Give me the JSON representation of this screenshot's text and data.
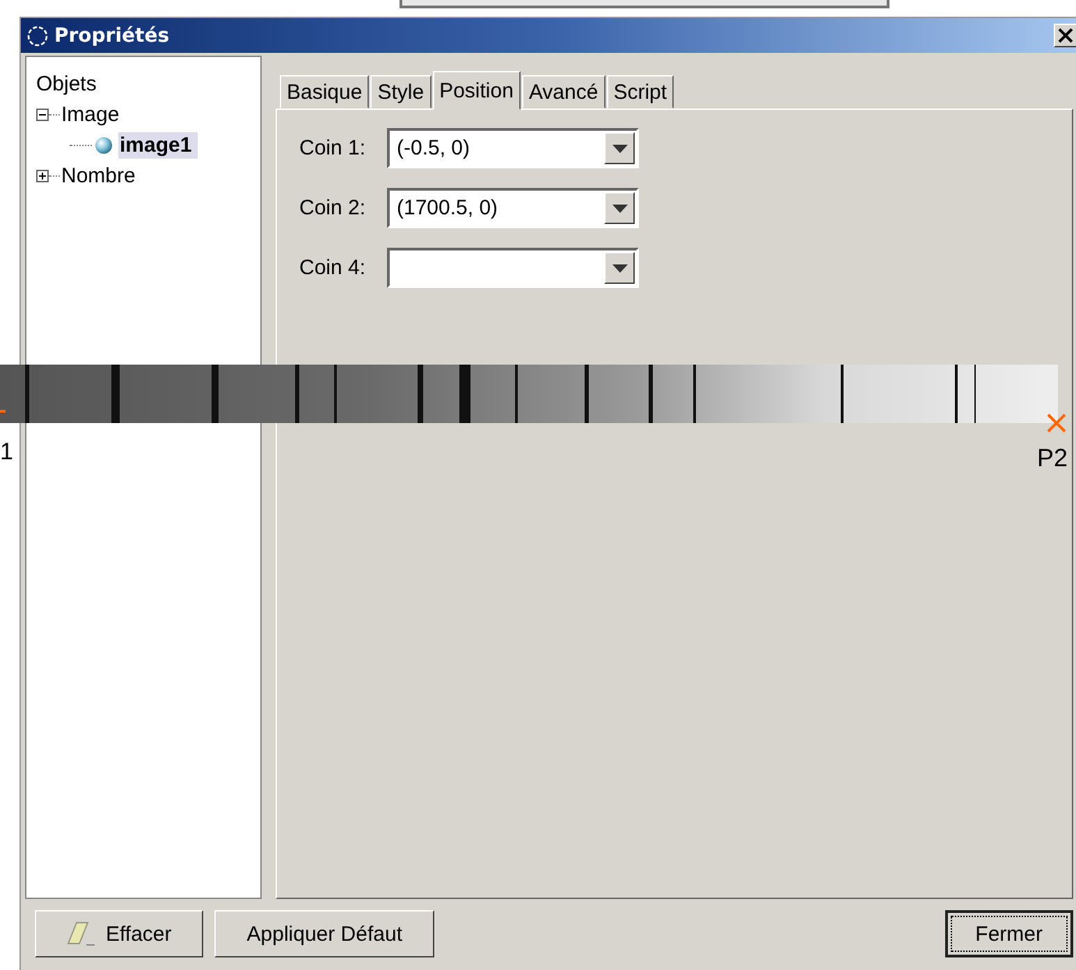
{
  "window": {
    "title": "Propriétés"
  },
  "tree": {
    "root": "Objets",
    "items": [
      {
        "label": "Image",
        "expanded": true,
        "selected": false,
        "children": [
          {
            "label": "image1",
            "selected": true
          }
        ]
      },
      {
        "label": "Nombre",
        "expanded": false,
        "selected": false
      }
    ]
  },
  "tabs": [
    {
      "label": "Basique",
      "selected": false
    },
    {
      "label": "Style",
      "selected": false
    },
    {
      "label": "Position",
      "selected": true
    },
    {
      "label": "Avancé",
      "selected": false
    },
    {
      "label": "Script",
      "selected": false
    }
  ],
  "fields": [
    {
      "label": "Coin 1:",
      "value": "(-0.5, 0)"
    },
    {
      "label": "Coin 2:",
      "value": "(1700.5, 0)"
    },
    {
      "label": "Coin 4:"
    }
  ],
  "canvas": {
    "points": [
      {
        "label": "1"
      },
      {
        "label": "P2"
      }
    ]
  },
  "buttons": [
    {
      "label": "Effacer",
      "kind": "eraser"
    },
    {
      "label": "Appliquer Défaut",
      "kind": "plain"
    },
    {
      "label": "Fermer",
      "kind": "focused"
    }
  ]
}
